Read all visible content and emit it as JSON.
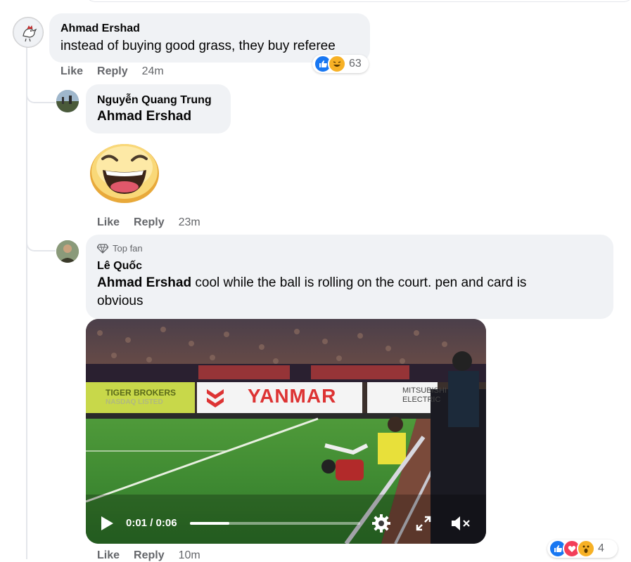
{
  "comments": [
    {
      "author": "Ahmad Ershad",
      "text": "instead of buying good grass, they buy referee",
      "actions": {
        "like": "Like",
        "reply": "Reply",
        "time": "24m"
      },
      "reactions": {
        "icons": [
          "like-icon",
          "haha-icon"
        ],
        "count": "63"
      }
    },
    {
      "author": "Nguyễn Quang Trung",
      "mention": "Ahmad Ershad",
      "sticker": "laughing-face-sticker",
      "actions": {
        "like": "Like",
        "reply": "Reply",
        "time": "23m"
      }
    },
    {
      "badge": "Top fan",
      "author": "Lê Quốc",
      "mention": "Ahmad Ershad",
      "text_line1": " cool while the ball is rolling on the court. pen and card is",
      "text_line2": "obvious",
      "video": {
        "ad_boards": [
          "TIGER BROKERS",
          "NASDAQ LISTED",
          "YANMAR",
          "MITSUBISHI",
          "ELECTRIC"
        ],
        "time_display": "0:01 / 0:06",
        "progress": 0.23
      },
      "actions": {
        "like": "Like",
        "reply": "Reply",
        "time": "10m"
      },
      "reactions": {
        "icons": [
          "like-icon",
          "love-icon",
          "wow-icon"
        ],
        "count": "4"
      }
    }
  ],
  "colors": {
    "bubble": "#f0f2f5",
    "meta_text": "#65676b",
    "like_blue": "#1877f2",
    "love_red": "#f33e58",
    "yellow": "#f7b125"
  }
}
